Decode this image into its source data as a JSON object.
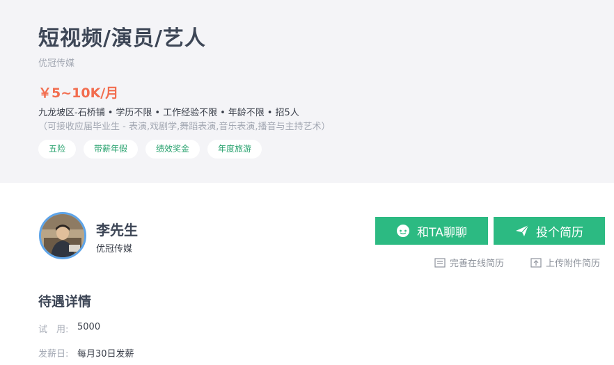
{
  "job": {
    "title": "短视频/演员/艺人",
    "company": "优冠传媒",
    "salary": "￥5~10K/月",
    "meta": [
      "九龙坡区-石桥铺",
      "学历不限",
      "工作经验不限",
      "年龄不限",
      "招5人"
    ],
    "note": "（可接收应届毕业生 - 表演,戏剧学,舞蹈表演,音乐表演,播音与主持艺术）",
    "tags": [
      "五险",
      "带薪年假",
      "绩效奖金",
      "年度旅游"
    ]
  },
  "recruiter": {
    "name": "李先生",
    "company": "优冠传媒"
  },
  "actions": {
    "chat_label": "和TA聊聊",
    "apply_label": "投个简历",
    "resume_label": "完善在线简历",
    "upload_label": "上传附件简历"
  },
  "benefits": {
    "title": "待遇详情",
    "rows": [
      {
        "key": "试　用:",
        "value": "5000"
      },
      {
        "key": "发薪日:",
        "value": "每月30日发薪"
      }
    ]
  },
  "colors": {
    "accent": "#2cba82",
    "salary": "#f26d4f",
    "tag_text": "#28a26e",
    "avatar_border": "#5ea4e8"
  },
  "icons": {
    "chat": "chat-bubble-icon",
    "apply": "paper-plane-icon",
    "resume": "document-icon",
    "upload": "upload-icon"
  }
}
